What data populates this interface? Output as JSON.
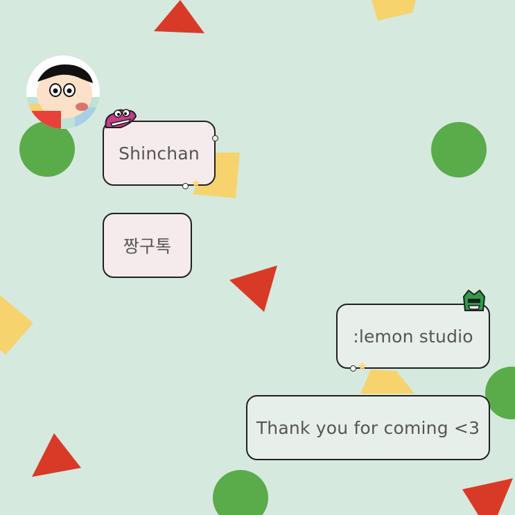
{
  "chat": {
    "sender_name": "Shinchan",
    "app_name": "짱구톡",
    "reply_name": ":lemon studio",
    "reply_message": "Thank you for coming <3"
  },
  "colors": {
    "background": "#d5e9de",
    "red_triangle": "#d93a27",
    "green_circle": "#5aab4a",
    "yellow_square": "#f7d36e",
    "bubble_pink": "#f6ebec",
    "bubble_gray": "#e7efea"
  },
  "icons": {
    "avatar": "shinchan-avatar",
    "sticker_left": "pink-crocodile-sticker",
    "sticker_right": "green-action-kamen-sticker",
    "star": "star-icon"
  }
}
